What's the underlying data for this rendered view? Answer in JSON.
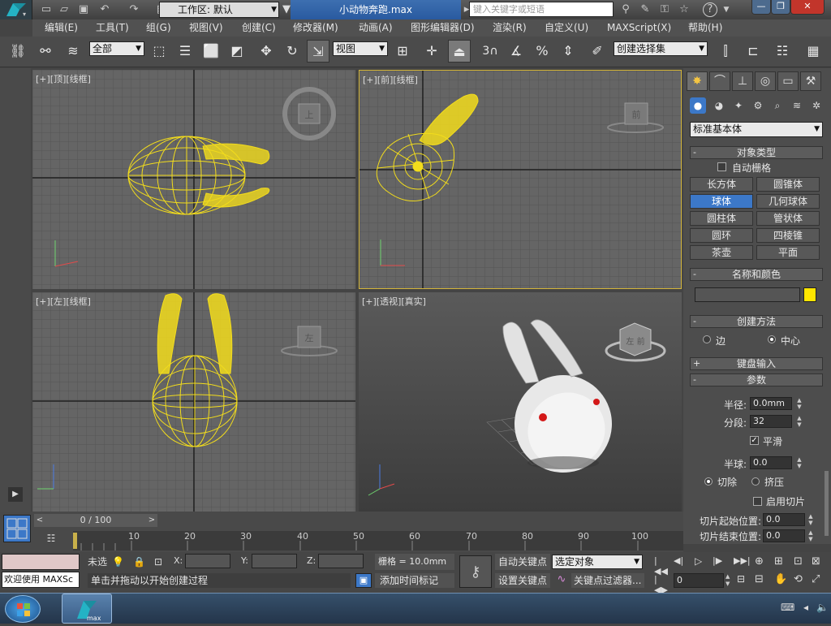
{
  "title_bar": {
    "workspace": "工作区: 默认",
    "file_title": "小动物奔跑.max",
    "search_placeholder": "键入关键字或短语"
  },
  "menu": [
    "编辑(E)",
    "工具(T)",
    "组(G)",
    "视图(V)",
    "创建(C)",
    "修改器(M)",
    "动画(A)",
    "图形编辑器(D)",
    "渲染(R)",
    "自定义(U)",
    "MAXScript(X)",
    "帮助(H)"
  ],
  "toolbar": {
    "selection_filter": "全部",
    "ref_coord": "视图",
    "snap_angle_label": "3",
    "named_selection": "创建选择集"
  },
  "viewports": {
    "top": {
      "label": "[+][顶][线框]",
      "cube": "上"
    },
    "front": {
      "label": "[+][前][线框]",
      "cube": "前"
    },
    "left": {
      "label": "[+][左][线框]",
      "cube": "左"
    },
    "persp": {
      "label": "[+][透视][真实]",
      "cube": "左 前"
    }
  },
  "command_panel": {
    "category": "标准基本体",
    "object_type": {
      "title": "对象类型",
      "autogrid": "自动栅格",
      "buttons": [
        "长方体",
        "圆锥体",
        "球体",
        "几何球体",
        "圆柱体",
        "管状体",
        "圆环",
        "四棱锥",
        "茶壶",
        "平面"
      ],
      "selected": "球体"
    },
    "name_color": {
      "title": "名称和颜色",
      "name_value": "",
      "color": "#ffe600"
    },
    "creation_method": {
      "title": "创建方法",
      "edge": "边",
      "center": "中心"
    },
    "keyboard_entry": {
      "title": "键盘输入"
    },
    "parameters": {
      "title": "参数",
      "radius_label": "半径:",
      "radius": "0.0mm",
      "segments_label": "分段:",
      "segments": "32",
      "smooth": "平滑",
      "hemisphere_label": "半球:",
      "hemisphere": "0.0",
      "chop": "切除",
      "squash": "挤压",
      "slice_on": "启用切片",
      "slice_from_label": "切片起始位置:",
      "slice_from": "0.0",
      "slice_to_label": "切片结束位置:",
      "slice_to": "0.0"
    }
  },
  "timeline": {
    "frame_display": "0 / 100",
    "ticks": [
      "10",
      "20",
      "30",
      "40",
      "50",
      "60",
      "70",
      "80",
      "90",
      "100"
    ]
  },
  "status": {
    "script_label": "欢迎使用 MAXSc",
    "selection": "未选",
    "x_label": "X:",
    "y_label": "Y:",
    "z_label": "Z:",
    "grid": "栅格 = 10.0mm",
    "prompt": "单击并拖动以开始创建过程",
    "add_time_tag": "添加时间标记",
    "auto_key": "自动关键点",
    "set_key": "设置关键点",
    "selected_object": "选定对象",
    "key_filters": "关键点过滤器...",
    "current_frame": "0"
  },
  "colors": {
    "wire": "#f2dc1c",
    "accent": "#3c78c8"
  }
}
